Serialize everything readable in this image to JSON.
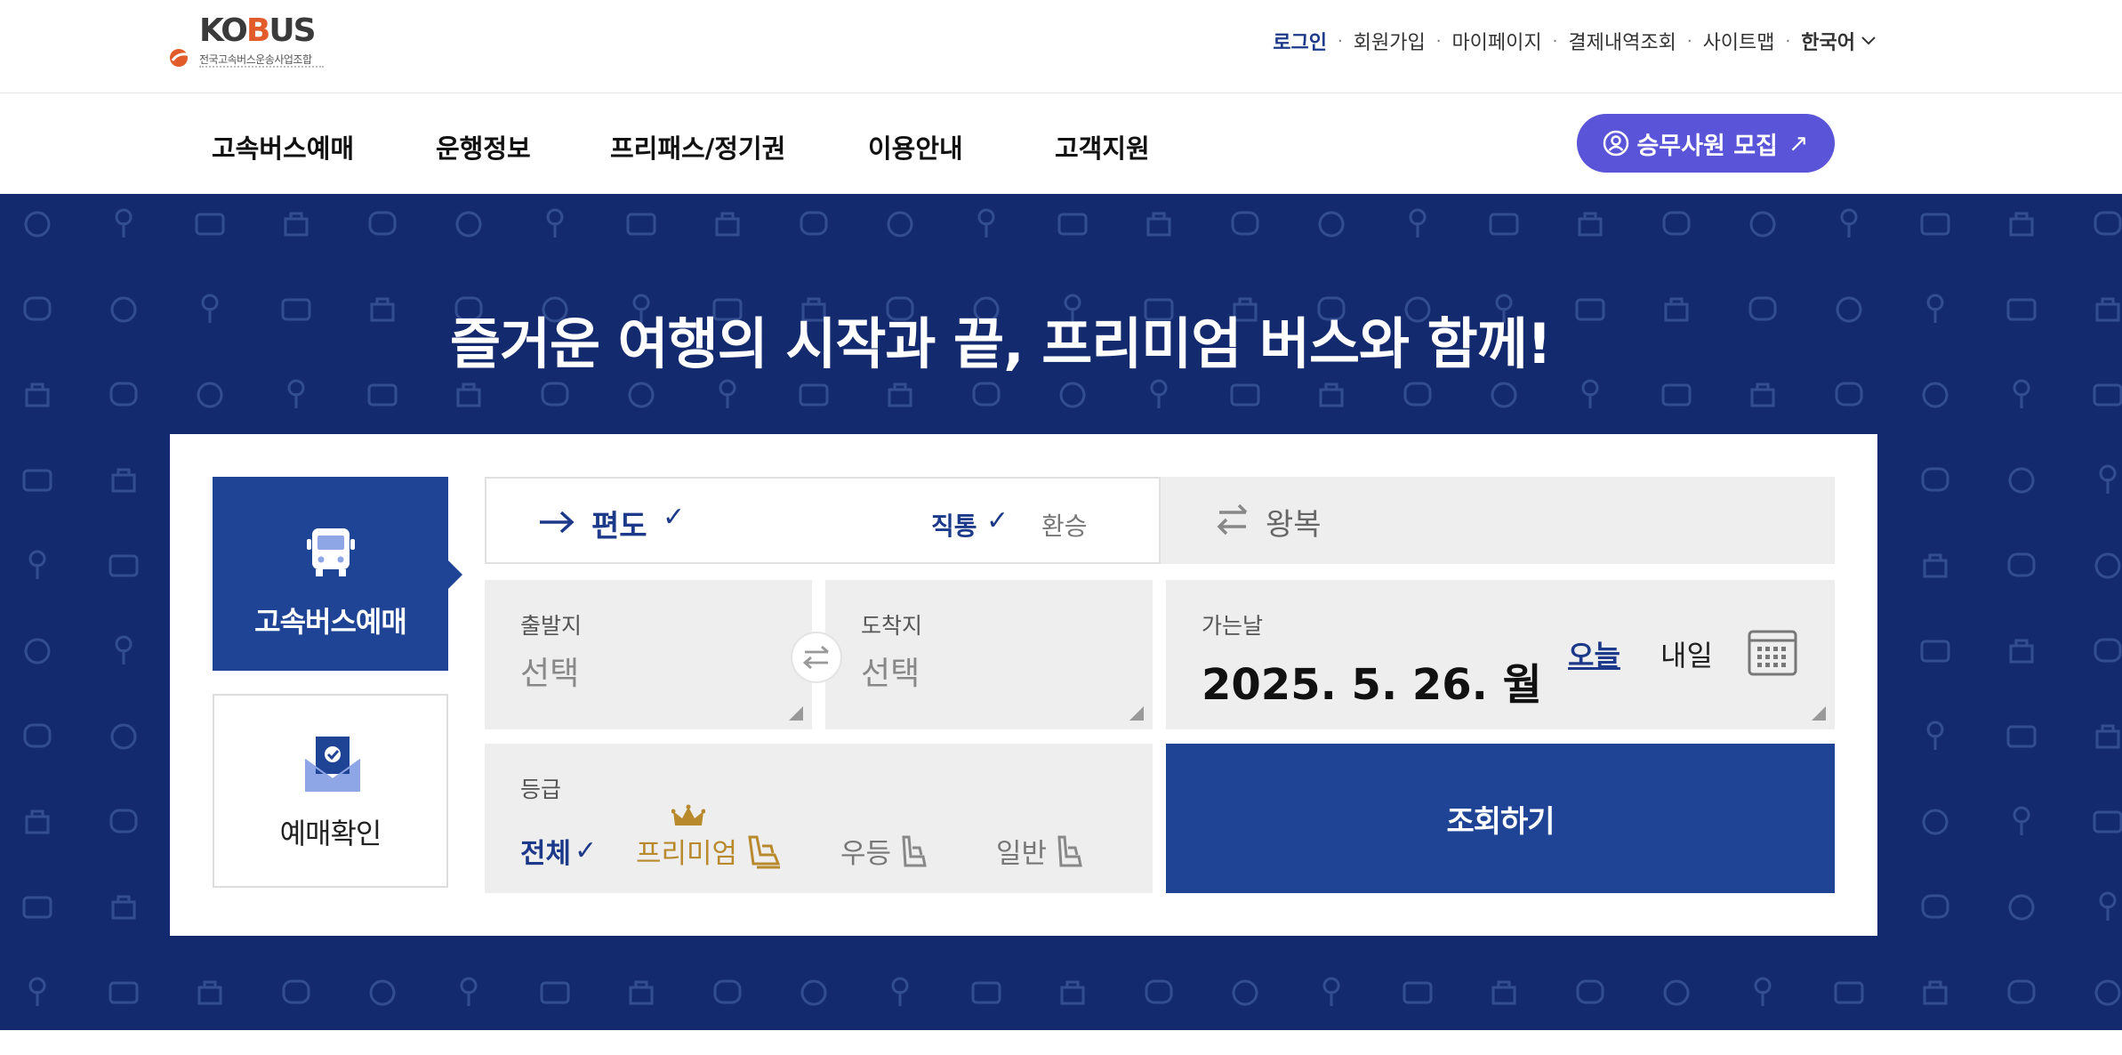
{
  "header": {
    "logo_word_pre": "KO",
    "logo_word_b": "B",
    "logo_word_post": "US",
    "logo_subtitle": "전국고속버스운송사업조합",
    "utility_links": [
      {
        "label": "로그인"
      },
      {
        "label": "회원가입"
      },
      {
        "label": "마이페이지"
      },
      {
        "label": "결제내역조회"
      },
      {
        "label": "사이트맵"
      }
    ],
    "language": "한국어"
  },
  "nav": {
    "items": [
      {
        "label": "고속버스예매"
      },
      {
        "label": "운행정보"
      },
      {
        "label": "프리패스/정기권"
      },
      {
        "label": "이용안내"
      },
      {
        "label": "고객지원"
      }
    ],
    "recruit_label": "승무사원 모집",
    "recruit_arrow": "↗"
  },
  "hero": {
    "title": "즐거운 여행의 시작과 끝, 프리미엄 버스와 함께!"
  },
  "booking": {
    "side_tabs": [
      {
        "label": "고속버스예매",
        "active": true
      },
      {
        "label": "예매확인",
        "active": false
      }
    ],
    "trip": {
      "oneway_label": "편도",
      "direct_label": "직통",
      "transfer_label": "환승",
      "roundtrip_label": "왕복",
      "check": "✓"
    },
    "departure": {
      "label": "출발지",
      "value": "선택"
    },
    "arrival": {
      "label": "도착지",
      "value": "선택"
    },
    "date": {
      "label": "가는날",
      "value": "2025. 5. 26. 월",
      "today": "오늘",
      "tomorrow": "내일"
    },
    "grade": {
      "label": "등급",
      "options": [
        {
          "label": "전체"
        },
        {
          "label": "프리미엄"
        },
        {
          "label": "우등"
        },
        {
          "label": "일반"
        }
      ]
    },
    "search_label": "조회하기"
  },
  "colors": {
    "brand_navy": "#142a6e",
    "primary_blue": "#1f4496",
    "recruit_purple": "#5a54d8",
    "premium_gold": "#b8892d"
  }
}
